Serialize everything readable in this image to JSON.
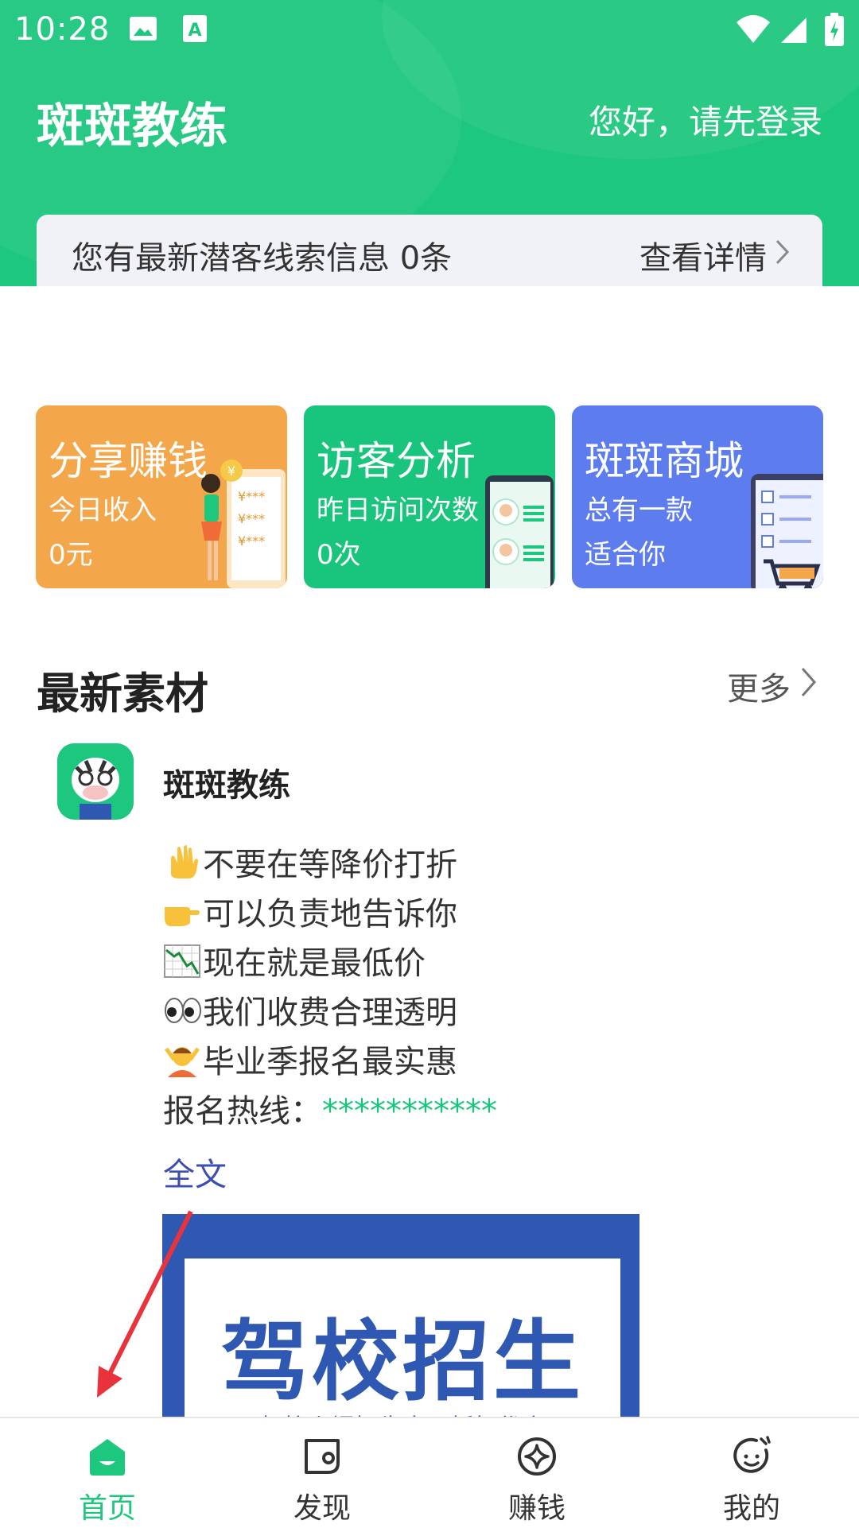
{
  "status_bar": {
    "time": "10:28"
  },
  "header": {
    "app_title": "斑斑教练",
    "login_prompt": "您好，请先登录",
    "notice_text": "您有最新潜客线索信息 0条",
    "notice_link": "查看详情"
  },
  "cards": [
    {
      "title": "分享赚钱",
      "line1": "今日收入",
      "line2": "0元",
      "color": "#f3a64a"
    },
    {
      "title": "访客分析",
      "line1": "昨日访问次数",
      "line2": "0次",
      "color": "#19c57c"
    },
    {
      "title": "斑斑商城",
      "line1": "总有一款",
      "line2": "适合你",
      "color": "#5d7cee"
    }
  ],
  "card_art": {
    "share_labels": [
      "¥***",
      "¥***",
      "¥***"
    ]
  },
  "section": {
    "title": "最新素材",
    "more": "更多"
  },
  "post": {
    "author": "斑斑教练",
    "lines": [
      {
        "icon": "raised-hand-icon",
        "text": "不要在等降价打折"
      },
      {
        "icon": "pointing-hand-icon",
        "text": "可以负责地告诉你"
      },
      {
        "icon": "chart-down-icon",
        "text": "现在就是最低价"
      },
      {
        "icon": "eyes-icon",
        "text": "我们收费合理透明"
      },
      {
        "icon": "person-gesturing-icon",
        "text": "毕业季报名最实惠"
      }
    ],
    "hotline_label": "报名热线：",
    "hotline_value": "***********",
    "fulltext_link": "全文",
    "poster_title": "驾校招生",
    "poster_subtitle": "—驾校火爆招生中，折扣优惠—"
  },
  "tabs": [
    {
      "label": "首页",
      "icon": "home-icon",
      "active": true
    },
    {
      "label": "发现",
      "icon": "discover-icon",
      "active": false
    },
    {
      "label": "赚钱",
      "icon": "earn-icon",
      "active": false
    },
    {
      "label": "我的",
      "icon": "profile-icon",
      "active": false
    }
  ],
  "colors": {
    "brand": "#1dc77e",
    "link": "#3d4db0",
    "arrow": "#e8323c"
  }
}
